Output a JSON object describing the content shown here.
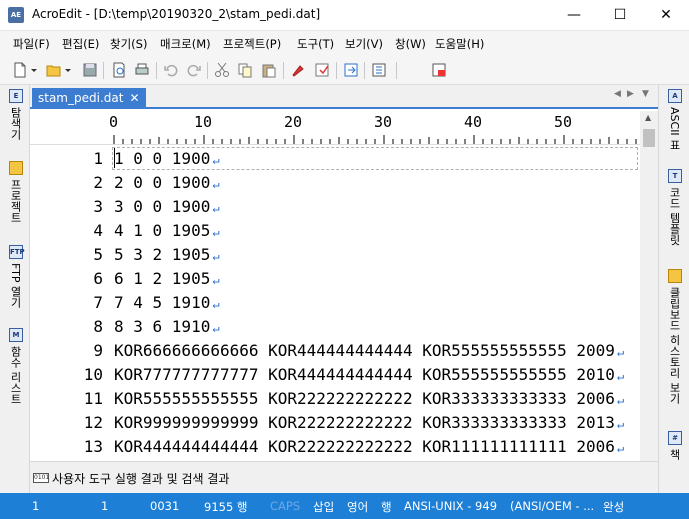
{
  "window": {
    "app_icon_text": "AE",
    "title": "AcroEdit - [D:\\temp\\20190320_2\\stam_pedi.dat]",
    "minimize": "—",
    "maximize": "☐",
    "close": "✕"
  },
  "menu": [
    "파일(F)",
    "편집(E)",
    "찾기(S)",
    "매크로(M)",
    "프로젝트(P)",
    "도구(T)",
    "보기(V)",
    "창(W)",
    "도움말(H)"
  ],
  "left_panel": [
    "탐색기",
    "프로젝트",
    "FTP 열기",
    "함수 리스트"
  ],
  "right_panel": [
    "ASCII 표",
    "코드 템플릿",
    "클립보드 히스토리 보기",
    "책"
  ],
  "tab": {
    "label": "stam_pedi.dat",
    "close": "✕"
  },
  "ruler": [
    "0",
    "10",
    "20",
    "30",
    "40",
    "50"
  ],
  "lines": [
    {
      "n": "1",
      "text": "1 0 0 1900"
    },
    {
      "n": "2",
      "text": "2 0 0 1900"
    },
    {
      "n": "3",
      "text": "3 0 0 1900"
    },
    {
      "n": "4",
      "text": "4 1 0 1905"
    },
    {
      "n": "5",
      "text": "5 3 2 1905"
    },
    {
      "n": "6",
      "text": "6 1 2 1905"
    },
    {
      "n": "7",
      "text": "7 4 5 1910"
    },
    {
      "n": "8",
      "text": "8 3 6 1910"
    },
    {
      "n": "9",
      "text": "KOR666666666666 KOR444444444444 KOR555555555555 2009"
    },
    {
      "n": "10",
      "text": "KOR777777777777 KOR444444444444 KOR555555555555 2010"
    },
    {
      "n": "11",
      "text": "KOR555555555555 KOR222222222222 KOR333333333333 2006"
    },
    {
      "n": "12",
      "text": "KOR999999999999 KOR222222222222 KOR333333333333 2013"
    },
    {
      "n": "13",
      "text": "KOR444444444444 KOR222222222222 KOR111111111111 2006"
    }
  ],
  "eol_mark": "↵",
  "output": {
    "icon_text": "0101",
    "label": "사용자 도구 실행 결과 및 검색 결과"
  },
  "status": {
    "line": "1",
    "col": "1",
    "code": "0031",
    "count": "9155 행",
    "caps": "CAPS",
    "insert": "삽입",
    "lang": "영어",
    "mode": "행",
    "encoding": "ANSI-UNIX - 949",
    "encoding2": "(ANSI/OEM - ...",
    "done": "완성"
  },
  "colors": {
    "accent": "#3c7dd1",
    "status": "#1e7fd6",
    "eol": "#2b6fc7"
  }
}
